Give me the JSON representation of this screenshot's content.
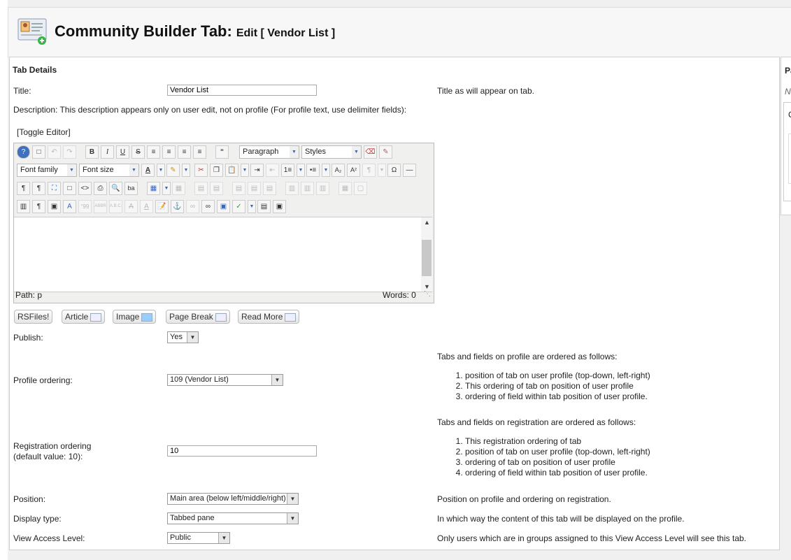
{
  "header": {
    "title": "Community Builder Tab:",
    "subtitle": "Edit [ Vendor List ]"
  },
  "right_panel": {
    "label1": "Pa",
    "label2": "N",
    "label3": "C"
  },
  "section_title": "Tab Details",
  "fields": {
    "title_label": "Title:",
    "title_value": "Vendor List",
    "title_help": "Title as will appear on tab.",
    "description_label": "Description: This description appears only on user edit, not on profile (For profile text, use delimiter fields):",
    "toggle_editor": "[Toggle Editor]",
    "publish_label": "Publish:",
    "publish_value": "Yes",
    "profile_ordering_label": "Profile ordering:",
    "profile_ordering_value": "109 (Vendor List)",
    "profile_help_title": "Tabs and fields on profile are ordered as follows:",
    "profile_help_items": [
      "position of tab on user profile (top-down, left-right)",
      "This ordering of tab on position of user profile",
      "ordering of field within tab position of user profile."
    ],
    "registration_label_1": "Registration ordering",
    "registration_label_2": "(default value: 10):",
    "registration_value": "10",
    "registration_help_title": "Tabs and fields on registration are ordered as follows:",
    "registration_help_items": [
      "This registration ordering of tab",
      "position of tab on user profile (top-down, left-right)",
      "ordering of tab on position of user profile",
      "ordering of field within tab position of user profile."
    ],
    "position_label": "Position:",
    "position_value": "Main area (below left/middle/right)",
    "position_help": "Position on profile and ordering on registration.",
    "display_label": "Display type:",
    "display_value": "Tabbed pane",
    "display_help": "In which way the content of this tab will be displayed on the profile.",
    "access_label": "View Access Level:",
    "access_value": "Public",
    "access_help": "Only users which are in groups assigned to this View Access Level will see this tab."
  },
  "editor": {
    "format_dropdown": "Paragraph",
    "styles_dropdown": "Styles",
    "font_family_dropdown": "Font family",
    "font_size_dropdown": "Font size",
    "path": "Path:  p",
    "words": "Words: 0"
  },
  "extra_buttons": {
    "rsfiles": "RSFiles!",
    "article": "Article",
    "image": "Image",
    "page_break": "Page Break",
    "read_more": "Read More"
  }
}
